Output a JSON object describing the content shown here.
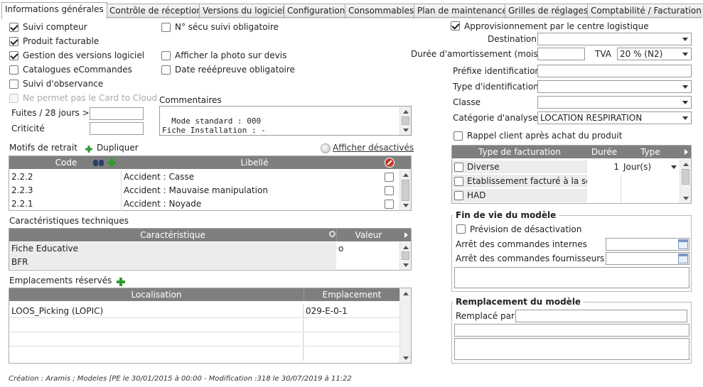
{
  "tabs": [
    {
      "label": "Informations générales"
    },
    {
      "label": "Contrôle de réception"
    },
    {
      "label": "Versions du logiciel"
    },
    {
      "label": "Configuration"
    },
    {
      "label": "Consommables"
    },
    {
      "label": "Plan de maintenance"
    },
    {
      "label": "Grilles de réglages"
    },
    {
      "label": "Comptabilité / Facturation"
    }
  ],
  "left": {
    "checks": {
      "suivi_compteur": "Suivi compteur",
      "produit_facturable": "Produit facturable",
      "gestion_versions": "Gestion des versions logiciel",
      "catalogues": "Catalogues eCommandes",
      "suivi_observance": "Suivi d'observance",
      "card_to_cloud": "Ne permet pas le Card to Cloud",
      "secu": "N° sécu suivi obligatoire",
      "photo_devis": "Afficher la photo sur devis",
      "date_reepreuve": "Date reéépreuve obligatoire"
    },
    "fuites_label": "Fuites / 28 jours >",
    "fuites_value": "",
    "criticite_label": "Criticité",
    "criticite_value": "",
    "commentaires_label": "Commentaires",
    "commentaires_text": "Mode standard : 000\nFiche Installation : -\nComptabiliser pour planning Rdv : N",
    "motifs": {
      "title": "Motifs de retrait",
      "dupliquer": "Dupliquer",
      "afficher_desactives": "Afficher désactivés",
      "col_code": "Code",
      "col_libelle": "Libellé",
      "rows": [
        {
          "code": "2.2.2",
          "libelle": "Accident : Casse"
        },
        {
          "code": "2.2.3",
          "libelle": "Accident : Mauvaise manipulation"
        },
        {
          "code": "2.2.1",
          "libelle": "Accident : Noyade"
        }
      ]
    },
    "caracteristiques": {
      "title": "Caractéristiques techniques",
      "col_carac": "Caractéristique",
      "col_valeur": "Valeur",
      "rows": [
        {
          "carac": "Fiche Educative",
          "valeur": "o"
        },
        {
          "carac": "BFR",
          "valeur": ""
        }
      ]
    },
    "emplacements": {
      "title": "Emplacements réservés",
      "col_localisation": "Localisation",
      "col_emplacement": "Emplacement",
      "rows": [
        {
          "localisation": "LOOS_Picking (LOPIC)",
          "emplacement": "029-E-0-1"
        }
      ]
    }
  },
  "right": {
    "appro_label": "Approvisionnement par le centre logistique",
    "destination_label": "Destination",
    "destination_value": "",
    "duree_label": "Durée d'amortissement (mois)",
    "duree_value": "",
    "tva_label": "TVA",
    "tva_value": "20 % (N2)",
    "prefixe_label": "Préfixe identification",
    "prefixe_value": "",
    "type_ident_label": "Type d'identification",
    "type_ident_value": "",
    "classe_label": "Classe",
    "classe_value": "",
    "categorie_label": "Catégorie d'analyse",
    "categorie_value": "LOCATION RESPIRATION",
    "rappel_label": "Rappel client après achat du produit",
    "facturation": {
      "col_type": "Type de facturation",
      "col_duree": "Durée",
      "col_type2": "Type",
      "rows": [
        {
          "type": "Diverse",
          "duree": "1",
          "unite": "Jour(s)"
        },
        {
          "type": "Etablissement facturé à la se",
          "duree": "",
          "unite": ""
        },
        {
          "type": "HAD",
          "duree": "",
          "unite": ""
        }
      ]
    },
    "fin_de_vie": {
      "legend": "Fin de vie du modèle",
      "prevision": "Prévision de désactivation",
      "arret_internes": "Arrêt des commandes internes",
      "arret_fournisseurs": "Arrêt des commandes fournisseurs"
    },
    "remplacement": {
      "legend": "Remplacement du modèle",
      "remplace_par": "Remplacé par"
    }
  },
  "footer": "Création : Aramis ; Modeles [PE le 30/01/2015 à 00:00 - Modification :318 le 30/07/2019 à 11:22"
}
